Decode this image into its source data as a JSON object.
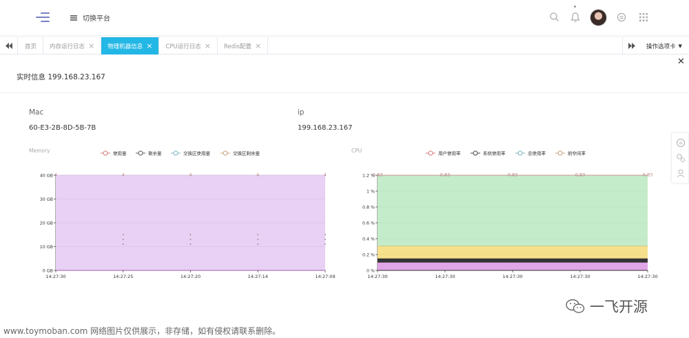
{
  "header": {
    "switch_label": "切换平台"
  },
  "tabs": [
    {
      "label": "首页",
      "closable": false,
      "active": false
    },
    {
      "label": "内存运行日志",
      "closable": true,
      "active": false
    },
    {
      "label": "物理机器信息",
      "closable": true,
      "active": true
    },
    {
      "label": "CPU运行日志",
      "closable": true,
      "active": false
    },
    {
      "label": "Redis配置",
      "closable": true,
      "active": false
    }
  ],
  "tab_ops_label": "操作选项卡",
  "accent": "#23b7e5",
  "realtime_title": "实时信息 199.168.23.167",
  "info": {
    "mac_label": "Mac",
    "mac_value": "60-E3-2B-8D-5B-7B",
    "ip_label": "ip",
    "ip_value": "199.168.23.167"
  },
  "chart_data": [
    {
      "type": "area",
      "title": "Memory",
      "legend": [
        "使用量",
        "剩余量",
        "交换区使用量",
        "交换区剩余量"
      ],
      "x": [
        "14:27:30",
        "14:27:25",
        "14:27:20",
        "14:27:14",
        "14:27:09"
      ],
      "y_ticks": [
        "0 GB",
        "10 GB",
        "20 GB",
        "30 GB",
        "40 GB"
      ],
      "ylim": [
        0,
        40
      ],
      "series": [
        {
          "name": "使用量",
          "values": [
            40,
            40,
            40,
            40,
            40
          ],
          "color": "#e8d1f4",
          "point_labels": [
            "4",
            "4",
            "4",
            "4",
            "4"
          ]
        },
        {
          "name": "剩余量",
          "values": [
            11,
            11,
            11,
            11,
            11
          ]
        },
        {
          "name": "交换区使用量",
          "values": [
            13,
            13,
            13,
            13,
            13
          ]
        },
        {
          "name": "交换区剩余量",
          "values": [
            15,
            15,
            15,
            15,
            15
          ]
        }
      ]
    },
    {
      "type": "area",
      "title": "CPU",
      "legend": [
        "用户使用率",
        "系统使用率",
        "总使用率",
        "前空闲率"
      ],
      "x": [
        "14:27:30",
        "14:27:30",
        "14:27:30",
        "14:27:30",
        "14:27:30"
      ],
      "y_ticks": [
        "0 %",
        "0.2 %",
        "0.4 %",
        "0.6 %",
        "0.8 %",
        "1 %",
        "1.2 %"
      ],
      "ylim": [
        0,
        1.2
      ],
      "series": [
        {
          "name": "前空闲率",
          "values": [
            1.2,
            1.2,
            1.2,
            1.2,
            1.2
          ],
          "color": "#c4ecca",
          "point_labels": [
            "0.83",
            "0.83",
            "0.83",
            "0.83",
            "0.83"
          ]
        },
        {
          "name": "总使用率",
          "values": [
            0.31,
            0.31,
            0.31,
            0.31,
            0.31
          ],
          "color": "#f6e08c"
        },
        {
          "name": "系统使用率",
          "values": [
            0.15,
            0.15,
            0.15,
            0.15,
            0.15
          ],
          "color": "#333333"
        },
        {
          "name": "用户使用率",
          "values": [
            0.1,
            0.1,
            0.1,
            0.1,
            0.1
          ],
          "color": "#e0a6e6"
        }
      ]
    }
  ],
  "watermark": {
    "left": "www.toymoban.com 网络图片仅供展示，非存储，如有侵权请联系删除。",
    "right": "一飞开源"
  }
}
